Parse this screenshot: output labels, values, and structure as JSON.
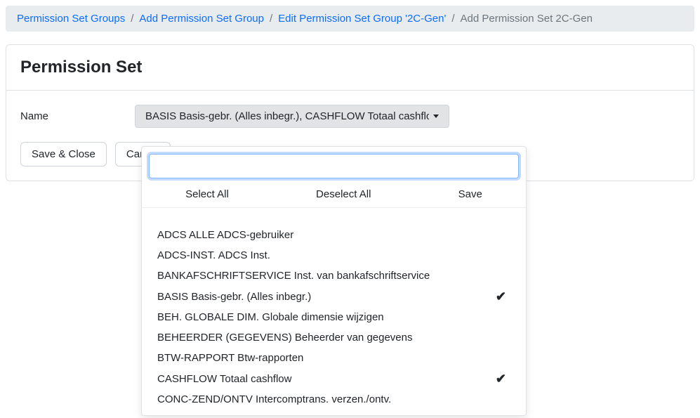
{
  "breadcrumb": {
    "items": [
      {
        "label": "Permission Set Groups",
        "link": true
      },
      {
        "label": "Add Permission Set Group",
        "link": true
      },
      {
        "label": "Edit Permission Set Group '2C-Gen'",
        "link": true
      },
      {
        "label": "Add Permission Set 2C-Gen",
        "link": false
      }
    ]
  },
  "panel": {
    "title": "Permission Set",
    "name_label": "Name",
    "select_display": "BASIS Basis-gebr. (Alles inbegr.), CASHFLOW Totaal cashflow",
    "save_close_label": "Save & Close",
    "cancel_label": "Cancel"
  },
  "dropdown": {
    "search_value": "",
    "select_all_label": "Select All",
    "deselect_all_label": "Deselect All",
    "save_label": "Save",
    "options": [
      {
        "label": "ADCS ALLE ADCS-gebruiker",
        "selected": false
      },
      {
        "label": "ADCS-INST. ADCS Inst.",
        "selected": false
      },
      {
        "label": "BANKAFSCHRIFTSERVICE Inst. van bankafschriftservice",
        "selected": false
      },
      {
        "label": "BASIS Basis-gebr. (Alles inbegr.)",
        "selected": true
      },
      {
        "label": "BEH. GLOBALE DIM. Globale dimensie wijzigen",
        "selected": false
      },
      {
        "label": "BEHEERDER (GEGEVENS) Beheerder van gegevens",
        "selected": false
      },
      {
        "label": "BTW-RAPPORT Btw-rapporten",
        "selected": false
      },
      {
        "label": "CASHFLOW Totaal cashflow",
        "selected": true
      },
      {
        "label": "CONC-ZEND/ONTV Intercomptrans. verzen./ontv.",
        "selected": false
      }
    ]
  }
}
